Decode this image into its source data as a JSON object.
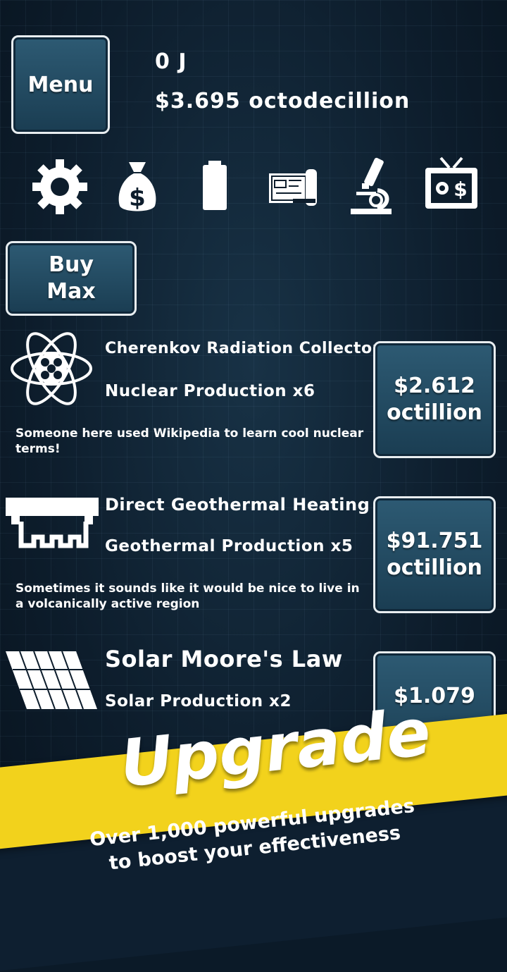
{
  "header": {
    "menu_label": "Menu",
    "energy": "0 J",
    "money": "$3.695 octodecillion"
  },
  "toolbar": {
    "icons": [
      "gear-icon",
      "money-bag-icon",
      "battery-icon",
      "blueprint-icon",
      "microscope-icon",
      "tv-icon"
    ]
  },
  "buy_max": {
    "line1": "Buy",
    "line2": "Max"
  },
  "upgrades": [
    {
      "title": "Cherenkov Radiation Collector",
      "effect": "Nuclear Production x6",
      "description": "Someone here used Wikipedia to learn cool nuclear terms!",
      "price_line1": "$2.612",
      "price_line2": "octillion",
      "icon": "atom-icon"
    },
    {
      "title": "Direct Geothermal Heating",
      "effect": "Geothermal Production x5",
      "description": "Sometimes it sounds like it would be nice to live in a volcanically active region",
      "price_line1": "$91.751",
      "price_line2": "octillion",
      "icon": "geothermal-icon"
    },
    {
      "title": "Solar Moore's Law",
      "effect": "Solar Production x2",
      "description": "",
      "price_line1": "$1.079",
      "price_line2": "",
      "icon": "solar-panel-icon"
    }
  ],
  "promo": {
    "title": "Upgrade",
    "subtitle": "Over 1,000 powerful upgrades to boost your effectiveness"
  },
  "colors": {
    "background": "#0b1a28",
    "button": "#1f4860",
    "banner": "#f2d21c"
  }
}
